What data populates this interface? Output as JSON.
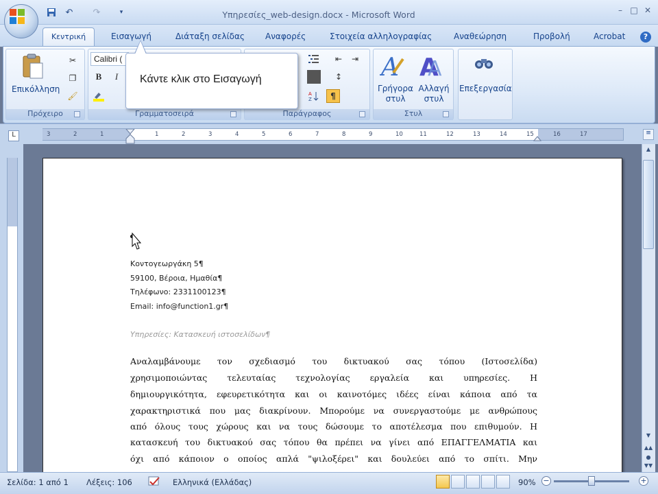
{
  "window": {
    "title": "Υπηρεσίες_web-design.docx - Microsoft Word",
    "controls": {
      "minimize": "–",
      "maximize": "□",
      "close": "✕"
    }
  },
  "quick_access": [
    {
      "icon": "save-icon"
    },
    {
      "icon": "undo-icon"
    },
    {
      "icon": "redo-icon"
    },
    {
      "icon": "customize-icon"
    }
  ],
  "tabs": [
    {
      "label": "Κεντρική",
      "active": true
    },
    {
      "label": "Εισαγωγή"
    },
    {
      "label": "Διάταξη σελίδας"
    },
    {
      "label": "Αναφορές"
    },
    {
      "label": "Στοιχεία αλληλογραφίας"
    },
    {
      "label": "Αναθεώρηση"
    },
    {
      "label": "Προβολή"
    },
    {
      "label": "Acrobat"
    }
  ],
  "ribbon": {
    "clipboard": {
      "paste_label": "Επικόλληση",
      "group_label": "Πρόχειρο"
    },
    "font": {
      "font_name": "Calibri (",
      "bold": "B",
      "italic": "I",
      "group_label": "Γραμματοσειρά"
    },
    "paragraph": {
      "group_label": "Παράγραφος",
      "pilcrow": "¶"
    },
    "styles": {
      "quick_styles_label": "Γρήγορα στυλ",
      "change_styles_label": "Αλλαγή στυλ",
      "group_label": "Στυλ"
    },
    "editing": {
      "label": "Επεξεργασία"
    }
  },
  "tooltip": {
    "text": "Κάντε κλικ στο Εισαγωγή"
  },
  "ruler": {
    "ticks": [
      "3",
      "2",
      "1",
      "1",
      "2",
      "3",
      "4",
      "5",
      "6",
      "7",
      "8",
      "9",
      "10",
      "11",
      "12",
      "13",
      "14",
      "15",
      "16",
      "17"
    ]
  },
  "document": {
    "cursor_mark": "¶",
    "address_lines": [
      "Κοντογεωργάκη 5¶",
      "59100, Βέροια, Ημαθία¶",
      "Τηλέφωνο: 2331100123¶",
      "Email: info@function1.gr¶"
    ],
    "subject": "Υπηρεσίες: Κατασκευή ιστοσελίδων¶",
    "body_lines": [
      "Αναλαμβάνουμε τον σχεδιασμό του δικτυακού σας τόπου (Ιστοσελίδα)",
      "χρησιμοποιώντας τελευταίας τεχνολογίας εργαλεία και υπηρεσίες. Η",
      "δημιουργικότητα, εφευρετικότητα και οι καινοτόμες ιδέες είναι κάποια από τα",
      "χαρακτηριστικά που μας διακρίνουν. Μπορούμε να συνεργαστούμε με ανθρώπους",
      "από όλους τους χώρους και να τους δώσουμε το αποτέλεσμα που επιθυμούν. Η",
      "κατασκευή του δικτυακού σας τόπου θα πρέπει να γίνει από ΕΠΑΓΓΕΛΜΑΤΙΑ και",
      "όχι από κάποιον ο οποίος απλά \"ψιλοξέρει\" και δουλεύει από το σπίτι. Μην"
    ]
  },
  "status": {
    "page": "Σελίδα: 1 από 1",
    "words": "Λέξεις: 106",
    "language": "Ελληνικά (Ελλάδας)",
    "zoom": "90%",
    "zoom_minus": "−",
    "zoom_plus": "+"
  }
}
